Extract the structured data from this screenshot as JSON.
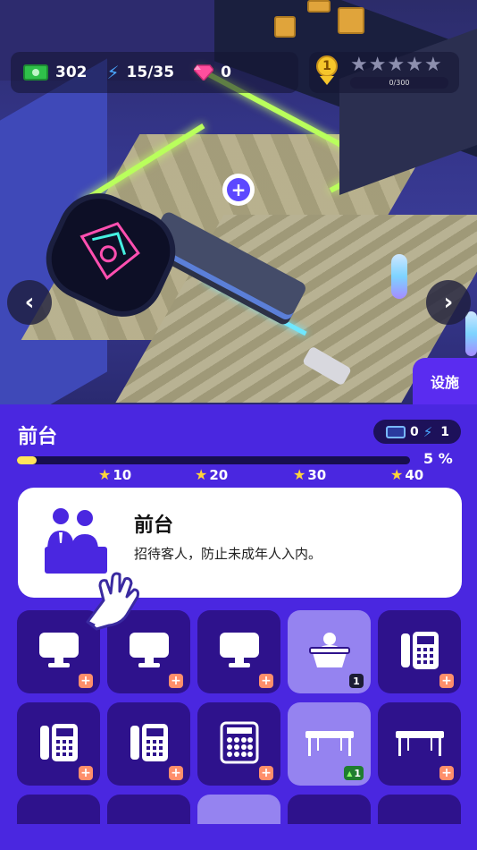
{
  "hud": {
    "cash": "302",
    "energy": "15/35",
    "gems": "0"
  },
  "rank": {
    "level": "1",
    "progress": "0/300",
    "stars_filled": 0,
    "stars_total": 5
  },
  "scene": {
    "facility_tab": "设施"
  },
  "panel": {
    "title": "前台",
    "cost_tickets": "0",
    "cost_energy": "1",
    "progress_percent": "5 %",
    "progress_value": 0.05,
    "milestones": [
      "10",
      "20",
      "30",
      "40"
    ]
  },
  "info": {
    "name": "前台",
    "description": "招待客人，防止未成年人入内。"
  },
  "colors": {
    "panel_bg": "#4a27e0",
    "tile_bg": "#2e128c",
    "tile_selected": "#9583f0",
    "progress_fill": "#ffe55b",
    "add_badge": "#ff8f6b"
  },
  "items": [
    {
      "icon": "monitor-icon",
      "badge": "add"
    },
    {
      "icon": "monitor-icon",
      "badge": "add"
    },
    {
      "icon": "monitor-icon",
      "badge": "add"
    },
    {
      "icon": "reception-bell-icon",
      "badge": "count",
      "count": "1",
      "selected": true
    },
    {
      "icon": "phone-icon",
      "badge": "add"
    },
    {
      "icon": "phone-icon",
      "badge": "add"
    },
    {
      "icon": "phone-icon",
      "badge": "add"
    },
    {
      "icon": "calculator-icon",
      "badge": "add"
    },
    {
      "icon": "table-icon",
      "badge": "upgrade",
      "count": "1",
      "selected": true
    },
    {
      "icon": "table-icon",
      "badge": "add"
    },
    {
      "icon": "shelf-icon",
      "badge": "none"
    },
    {
      "icon": "shelf-icon",
      "badge": "none"
    },
    {
      "icon": "bottle-icon",
      "badge": "none",
      "selected": true
    },
    {
      "icon": "document-icon",
      "badge": "none"
    },
    {
      "icon": "plant-icon",
      "badge": "none"
    }
  ]
}
